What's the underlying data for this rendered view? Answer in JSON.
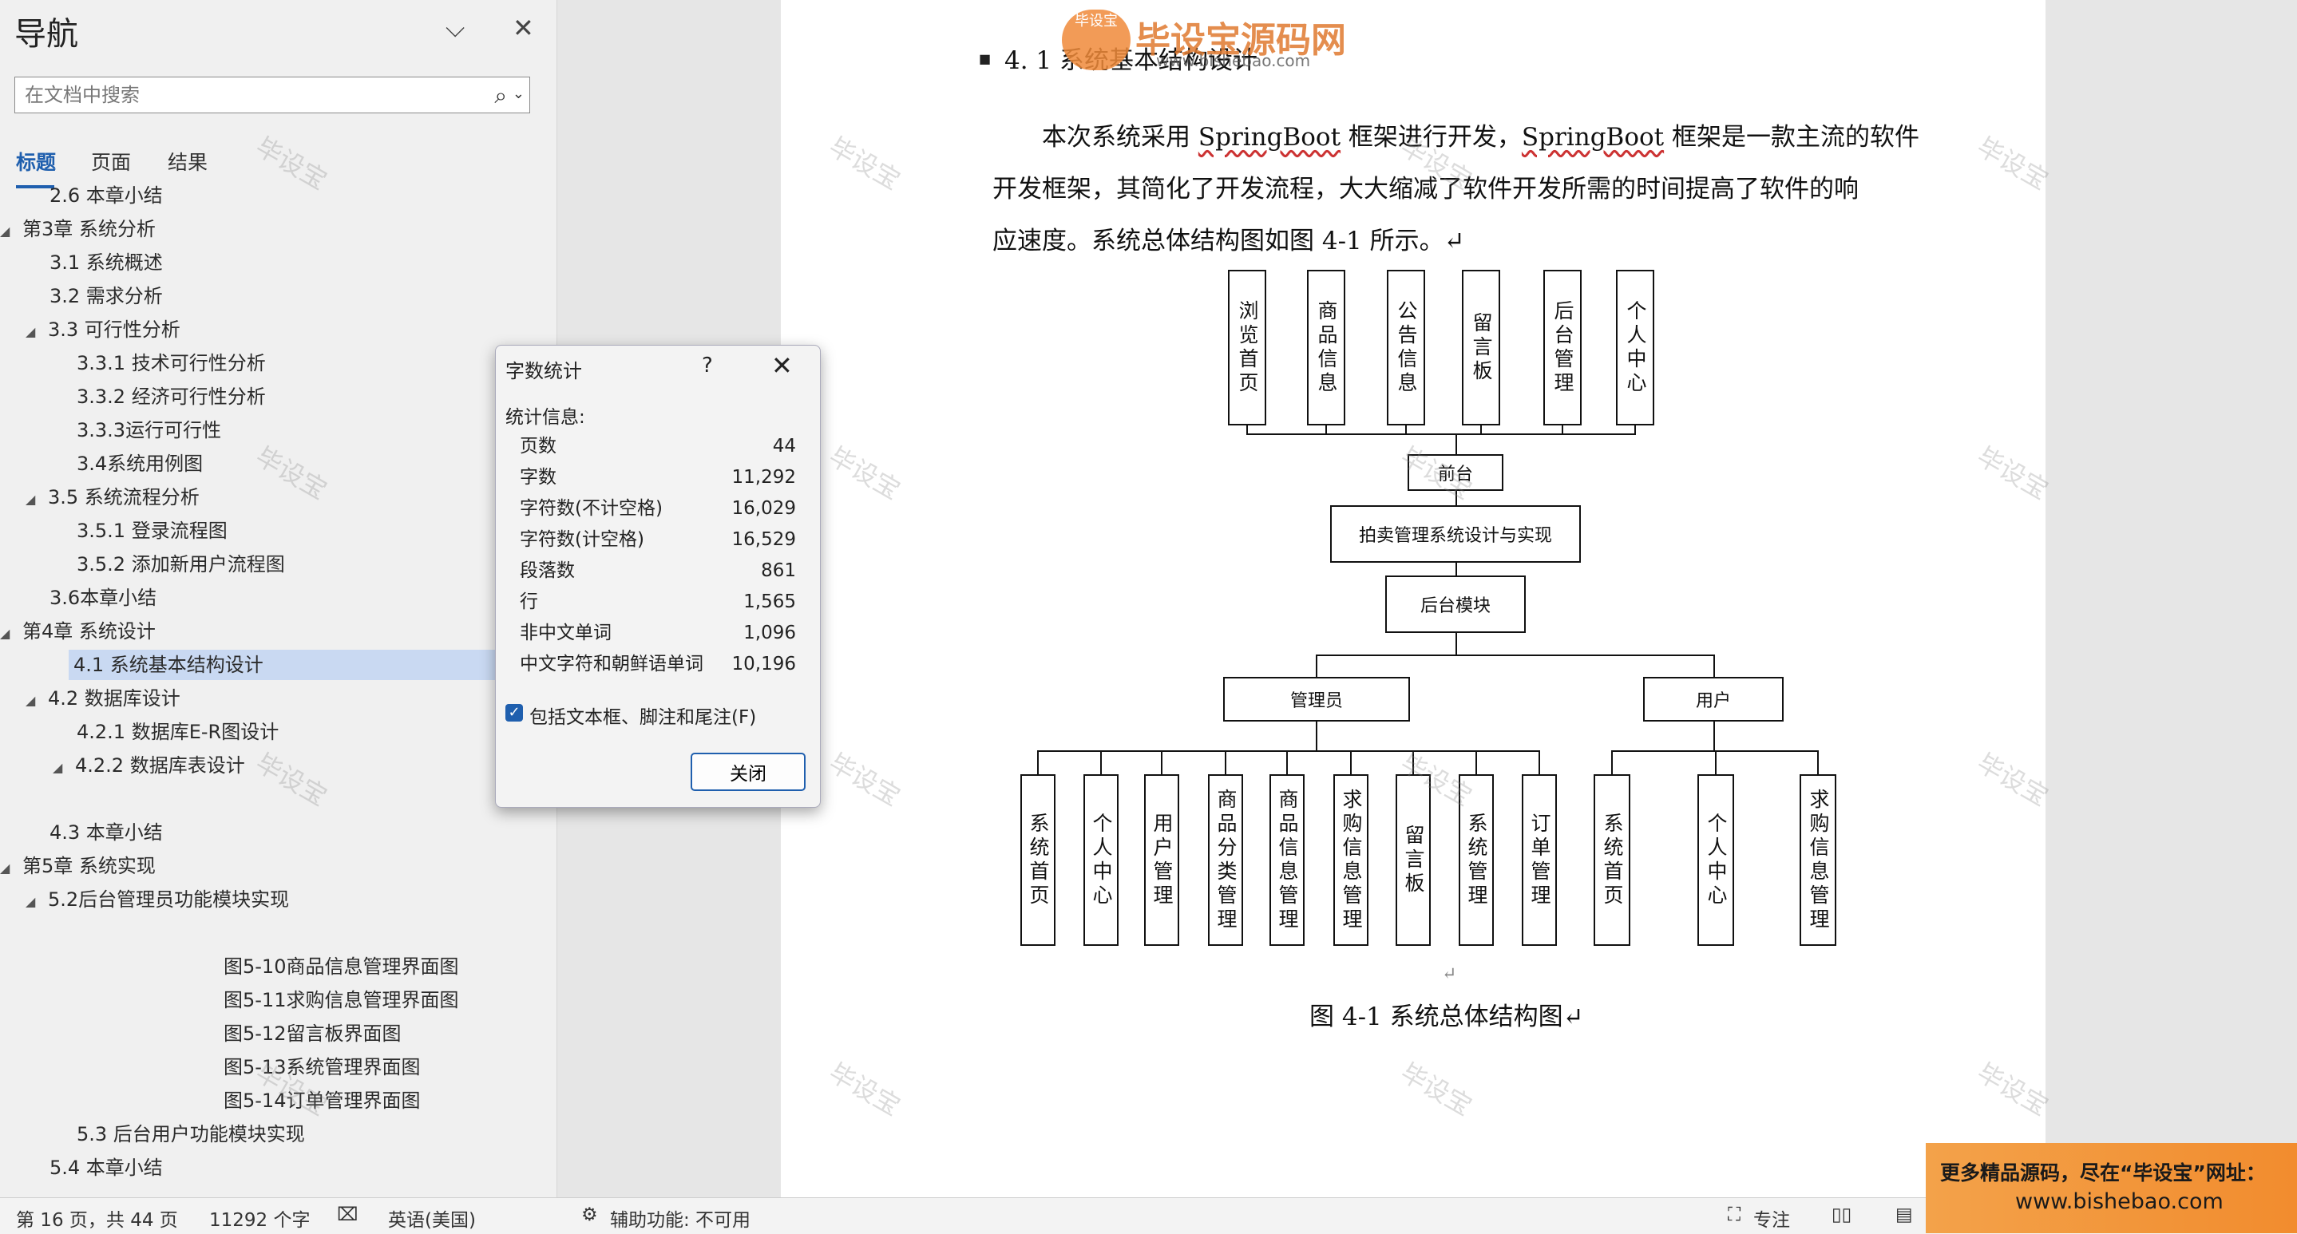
{
  "nav": {
    "title": "导航",
    "search_placeholder": "在文档中搜索",
    "tabs": [
      {
        "label": "标题"
      },
      {
        "label": "页面"
      },
      {
        "label": "结果"
      }
    ],
    "items": [
      {
        "text": "2.6 本章小结",
        "level": 2,
        "expander": ""
      },
      {
        "text": "第3章 系统分析",
        "level": 1,
        "expander": "◢"
      },
      {
        "text": "3.1 系统概述",
        "level": 2,
        "expander": ""
      },
      {
        "text": "3.2 需求分析",
        "level": 2,
        "expander": ""
      },
      {
        "text": "3.3 可行性分析",
        "level": 2,
        "expander": "◢"
      },
      {
        "text": "3.3.1 技术可行性分析",
        "level": 3,
        "expander": ""
      },
      {
        "text": "3.3.2 经济可行性分析",
        "level": 3,
        "expander": ""
      },
      {
        "text": "3.3.3运行可行性",
        "level": 3,
        "expander": ""
      },
      {
        "text": "3.4系统用例图",
        "level": 3,
        "expander": ""
      },
      {
        "text": "3.5 系统流程分析",
        "level": 2,
        "expander": "◢"
      },
      {
        "text": "3.5.1 登录流程图",
        "level": 3,
        "expander": ""
      },
      {
        "text": "3.5.2 添加新用户流程图",
        "level": 3,
        "expander": ""
      },
      {
        "text": "3.6本章小结",
        "level": 2,
        "expander": ""
      },
      {
        "text": "第4章 系统设计",
        "level": 1,
        "expander": "◢"
      },
      {
        "text": "4.1 系统基本结构设计",
        "level": 2,
        "expander": "",
        "selected": true
      },
      {
        "text": "4.2 数据库设计",
        "level": 2,
        "expander": "◢"
      },
      {
        "text": "4.2.1 数据库E-R图设计",
        "level": 3,
        "expander": ""
      },
      {
        "text": "4.2.2 数据库表设计",
        "level": 3,
        "expander": "◢"
      },
      {
        "text": "",
        "level": 3,
        "expander": ""
      },
      {
        "text": "4.3 本章小结",
        "level": 2,
        "expander": ""
      },
      {
        "text": "第5章 系统实现",
        "level": 1,
        "expander": "◢"
      },
      {
        "text": "5.2后台管理员功能模块实现",
        "level": 2,
        "expander": "◢"
      },
      {
        "text": "",
        "level": 3,
        "expander": ""
      },
      {
        "text": "图5-10商品信息管理界面图",
        "level": 4,
        "expander": ""
      },
      {
        "text": "图5-11求购信息管理界面图",
        "level": 4,
        "expander": ""
      },
      {
        "text": "图5-12留言板界面图",
        "level": 4,
        "expander": ""
      },
      {
        "text": "图5-13系统管理界面图",
        "level": 4,
        "expander": ""
      },
      {
        "text": "图5-14订单管理界面图",
        "level": 4,
        "expander": ""
      },
      {
        "text": "5.3 后台用户功能模块实现",
        "level": 3,
        "expander": ""
      },
      {
        "text": "5.4 本章小结",
        "level": 2,
        "expander": ""
      }
    ]
  },
  "dialog": {
    "title": "字数统计",
    "help": "?",
    "section": "统计信息:",
    "stats": [
      {
        "label": "页数",
        "value": "44"
      },
      {
        "label": "字数",
        "value": "11,292"
      },
      {
        "label": "字符数(不计空格)",
        "value": "16,029"
      },
      {
        "label": "字符数(计空格)",
        "value": "16,529"
      },
      {
        "label": "段落数",
        "value": "861"
      },
      {
        "label": "行",
        "value": "1,565"
      },
      {
        "label": "非中文单词",
        "value": "1,096"
      },
      {
        "label": "中文字符和朝鲜语单词",
        "value": "10,196"
      }
    ],
    "checkbox_label": "包括文本框、脚注和尾注(F)",
    "checkbox_checked": true,
    "close_label": "关闭"
  },
  "doc": {
    "heading": "4. 1    系统基本结构设计",
    "para_line1_a": "本次系统采用 ",
    "para_sb1": "SpringBoot",
    "para_line1_b": " 框架进行开发，",
    "para_sb2": "SpringBoot",
    "para_line1_c": " 框架是一款主流的软件",
    "para_line2": "开发框架，其简化了开发流程，大大缩减了软件开发所需的时间提高了软件的响",
    "para_line3": "应速度。系统总体结构图如图 4-1 所示。↵",
    "caption": "图 4-1    系统总体结构图↵",
    "empty_mark": "↵",
    "diagram": {
      "front_modules": [
        "浏览首页",
        "商品信息",
        "公告信息",
        "留言板",
        "后台管理",
        "个人中心"
      ],
      "front": "前台",
      "system": "拍卖管理系统设计与实现",
      "backend": "后台模块",
      "admin": "管理员",
      "user": "用户",
      "admin_modules": [
        "系统首页",
        "个人中心",
        "用户管理",
        "商品分类管理",
        "商品信息管理",
        "求购信息管理",
        "留言板",
        "系统管理",
        "订单管理"
      ],
      "user_modules": [
        "系统首页",
        "个人中心",
        "求购信息管理"
      ]
    }
  },
  "watermark": "毕设宝",
  "logo": {
    "badge": "毕设宝",
    "text": "毕设宝源码网",
    "url": "www.bishebao.com"
  },
  "ad": {
    "line1": "更多精品源码，尽在“毕设宝”网址：",
    "line2": "www.bishebao.com"
  },
  "status": {
    "page": "第 16 页，共 44 页",
    "words": "11292 个字",
    "language": "英语(美国)",
    "accessibility": "辅助功能: 不可用",
    "focus": "专注"
  }
}
